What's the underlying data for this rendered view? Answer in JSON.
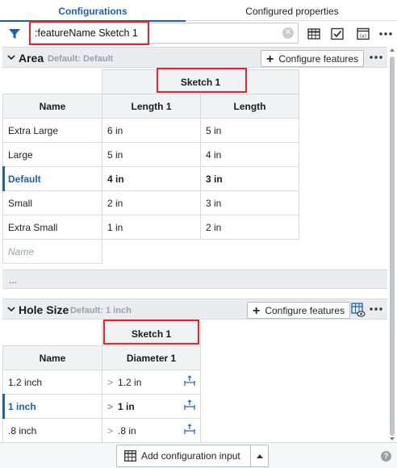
{
  "tabs": [
    {
      "label": "Configurations",
      "active": true
    },
    {
      "label": "Configured properties",
      "active": false
    }
  ],
  "filter": {
    "value": ":featureName Sketch 1"
  },
  "area": {
    "title": "Area",
    "default_text": "Default: Default",
    "configure_label": "Configure features",
    "group_header": "Sketch 1",
    "name_header": "Name",
    "columns": [
      "Length 1",
      "Length"
    ],
    "rows": [
      {
        "name": "Extra Large",
        "values": [
          "6 in",
          "5 in"
        ],
        "default": false
      },
      {
        "name": "Large",
        "values": [
          "5 in",
          "4 in"
        ],
        "default": false
      },
      {
        "name": "Default",
        "values": [
          "4 in",
          "3 in"
        ],
        "default": true
      },
      {
        "name": "Small",
        "values": [
          "2 in",
          "3 in"
        ],
        "default": false
      },
      {
        "name": "Extra Small",
        "values": [
          "1 in",
          "2 in"
        ],
        "default": false
      }
    ],
    "new_row_placeholder": "Name"
  },
  "collapsed_row": "...",
  "hole_size": {
    "title": "Hole Size",
    "default_text": "Default: 1 inch",
    "configure_label": "Configure features",
    "group_header": "Sketch 1",
    "name_header": "Name",
    "columns": [
      "Diameter 1"
    ],
    "rows": [
      {
        "name": "1.2 inch",
        "values": [
          "1.2 in"
        ],
        "default": false
      },
      {
        "name": "1 inch",
        "values": [
          "1 in"
        ],
        "default": true
      },
      {
        "name": ".8 inch",
        "values": [
          ".8 in"
        ],
        "default": false
      }
    ]
  },
  "bottom": {
    "add_label": "Add configuration input"
  },
  "colors": {
    "accent": "#1d5fb5",
    "highlight_box": "#e8242b"
  }
}
